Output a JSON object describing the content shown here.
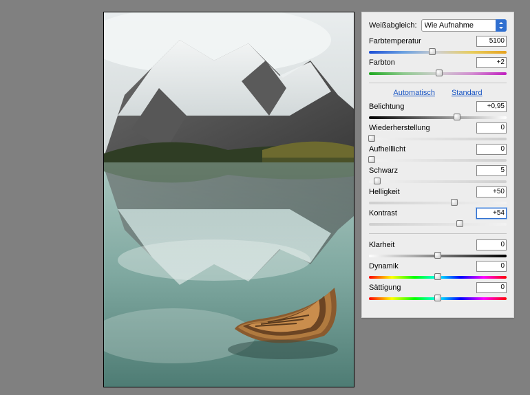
{
  "whitebalance": {
    "label": "Weißabgleich:",
    "selected": "Wie Aufnahme"
  },
  "links": {
    "auto": "Automatisch",
    "standard": "Standard"
  },
  "sliders": {
    "temp": {
      "label": "Farbtemperatur",
      "value": "5100",
      "pos": 46,
      "track": "g-temp"
    },
    "tint": {
      "label": "Farbton",
      "value": "+2",
      "pos": 51,
      "track": "g-tint"
    },
    "exposure": {
      "label": "Belichtung",
      "value": "+0,95",
      "pos": 64,
      "track": "g-expo"
    },
    "recovery": {
      "label": "Wiederherstellung",
      "value": "0",
      "pos": 2,
      "track": "g-gray"
    },
    "fill": {
      "label": "Aufhelllicht",
      "value": "0",
      "pos": 2,
      "track": "g-gray"
    },
    "black": {
      "label": "Schwarz",
      "value": "5",
      "pos": 6,
      "track": "g-gray"
    },
    "bright": {
      "label": "Helligkeit",
      "value": "+50",
      "pos": 62,
      "track": "g-gray2"
    },
    "contrast": {
      "label": "Kontrast",
      "value": "+54",
      "pos": 66,
      "track": "g-gray2",
      "active": true
    },
    "clarity": {
      "label": "Klarheit",
      "value": "0",
      "pos": 50,
      "track": "g-black"
    },
    "vibrance": {
      "label": "Dynamik",
      "value": "0",
      "pos": 50,
      "track": "g-hue"
    },
    "sat": {
      "label": "Sättigung",
      "value": "0",
      "pos": 50,
      "track": "g-hue"
    }
  },
  "icons": {
    "dropdown": "dropdown-icon"
  }
}
